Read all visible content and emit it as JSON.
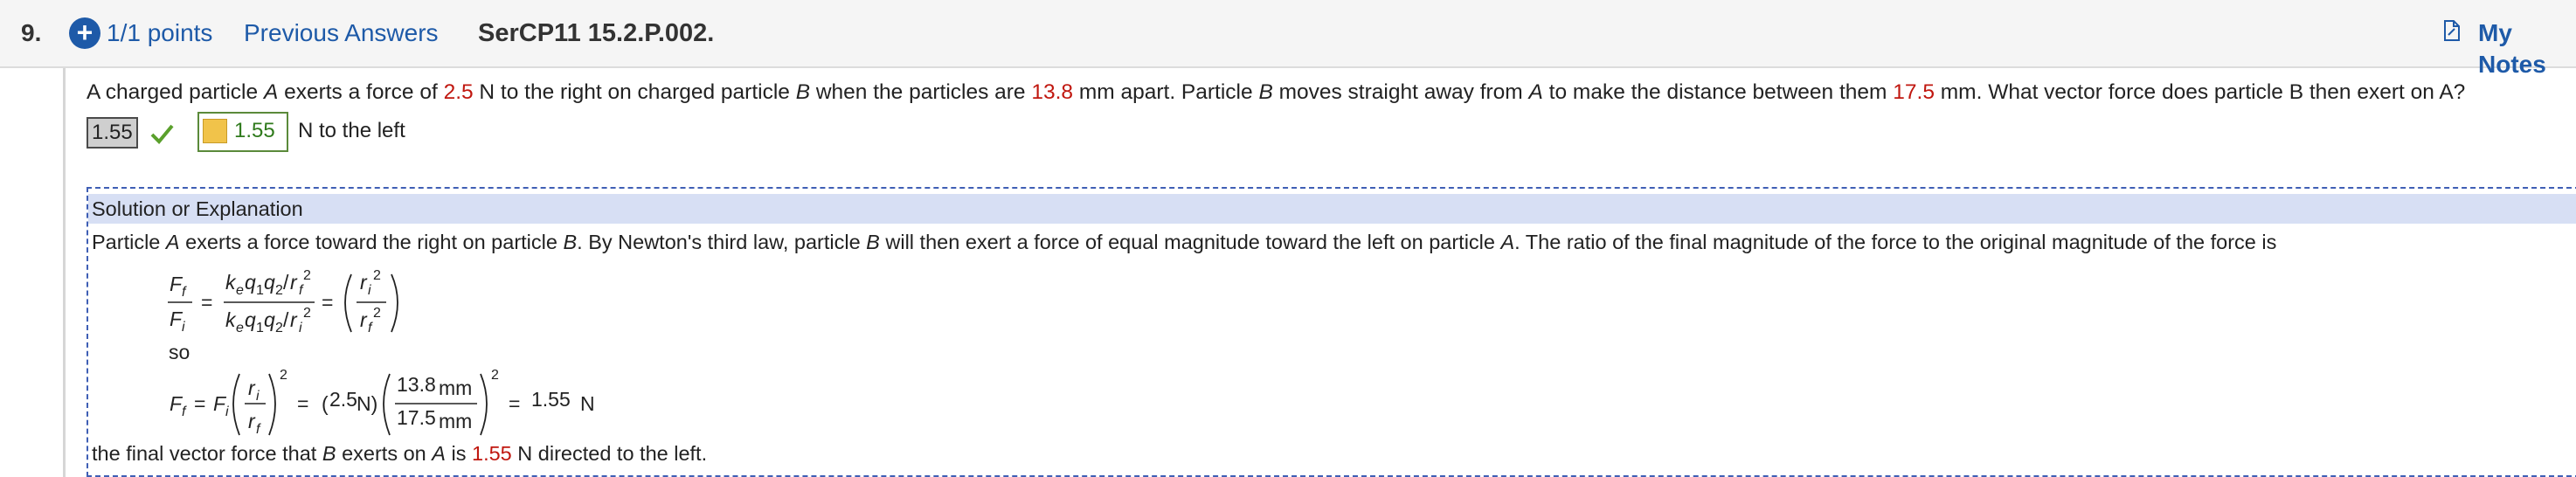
{
  "header": {
    "question_number": "9.",
    "points": "1/1 points",
    "previous_answers": "Previous Answers",
    "problem_code": "SerCP11 15.2.P.002.",
    "my_notes": "My Notes"
  },
  "question": {
    "t1": "A charged particle ",
    "A1": "A",
    "t2": " exerts a force of ",
    "force": "2.5",
    "t3": " N to the right on charged particle ",
    "B1": "B",
    "t4": " when the particles are ",
    "dist1": "13.8",
    "t5": " mm apart. Particle ",
    "B2": "B",
    "t6": " moves straight away from ",
    "A2": "A",
    "t7": " to make the distance between them ",
    "dist2": "17.5",
    "t8": " mm. What vector force does particle B then exert on A?"
  },
  "answer": {
    "entered": "1.55",
    "key_value": "1.55",
    "key_unit": "N to the left"
  },
  "solution": {
    "title": "Solution or Explanation",
    "p1_a": "Particle ",
    "p1_A": "A",
    "p1_b": " exerts a force toward the right on particle ",
    "p1_B": "B",
    "p1_c": ". By Newton's third law, particle ",
    "p1_B2": "B",
    "p1_d": " will then exert a force of equal magnitude toward the left on particle ",
    "p1_A2": "A",
    "p1_e": ". The ratio of the final magnitude of the force to the original magnitude of the force is",
    "so": "so",
    "eq2_force": "2.5",
    "eq2_num": "13.8",
    "eq2_den": "17.5",
    "eq2_result": "1.55",
    "final_a": "the final vector force that ",
    "final_B": "B",
    "final_b": " exerts on ",
    "final_A": "A",
    "final_c": " is ",
    "final_val": "1.55",
    "final_d": " N directed to the left."
  },
  "colors": {
    "link": "#1e5aa8",
    "highlight_red": "#c0170f",
    "correct_green": "#2f7a1c",
    "solution_header_bg": "#d7dff4"
  }
}
